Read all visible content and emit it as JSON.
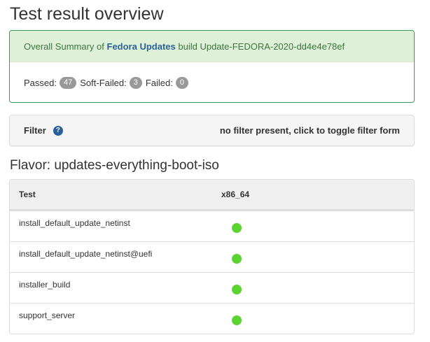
{
  "page_title": "Test result overview",
  "summary": {
    "prefix": "Overall Summary of",
    "product_link": "Fedora Updates",
    "build_text": "build Update-FEDORA-2020-dd4e4e78ef",
    "passed_label": "Passed:",
    "passed_count": "47",
    "softfailed_label": "Soft-Failed:",
    "softfailed_count": "3",
    "failed_label": "Failed:",
    "failed_count": "0"
  },
  "filter": {
    "label": "Filter",
    "help_icon": "?",
    "toggle_text": "no filter present, click to toggle filter form"
  },
  "flavor_title": "Flavor: updates-everything-boot-iso",
  "table": {
    "headers": [
      "Test",
      "x86_64"
    ],
    "rows": [
      {
        "name": "install_default_update_netinst",
        "status": "passed"
      },
      {
        "name": "install_default_update_netinst@uefi",
        "status": "passed"
      },
      {
        "name": "installer_build",
        "status": "passed"
      },
      {
        "name": "support_server",
        "status": "passed"
      }
    ]
  },
  "colors": {
    "summary_bg": "#dff0d8",
    "summary_border": "#3c9a58",
    "link": "#2a6496",
    "passed_dot": "#5cd32f",
    "badge": "#999999"
  }
}
